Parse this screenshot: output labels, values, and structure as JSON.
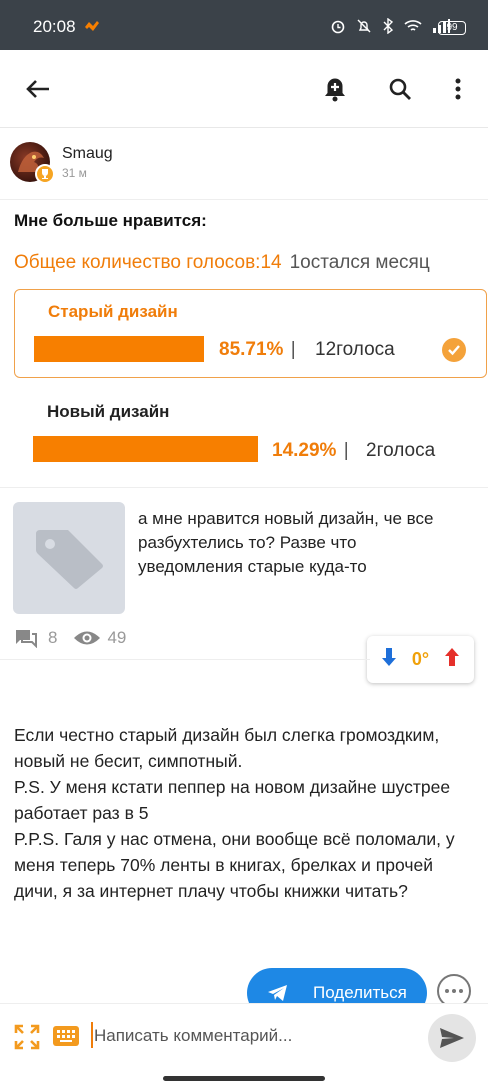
{
  "status_bar": {
    "time": "20:08",
    "battery": "99"
  },
  "author": {
    "name": "Smaug",
    "time": "31 м"
  },
  "poll": {
    "title": "Мне больше нравится:",
    "total_label": "Общее количество голосов:14",
    "remaining_label": "1остался месяц",
    "options": [
      {
        "label": "Старый дизайн",
        "percent": "85.71%",
        "percent_value": 85.71,
        "separator": "|",
        "votes": "12голоса",
        "selected": true
      },
      {
        "label": "Новый дизайн",
        "percent": "14.29%",
        "percent_value": 14.29,
        "separator": "|",
        "votes": "2голоса",
        "selected": false
      }
    ]
  },
  "linked_post": {
    "text": "а мне нравится новый дизайн, че все разбухтелись то? Разве что уведомления старые куда-то",
    "comments_count": "8",
    "views_count": "49"
  },
  "rating": {
    "value": "0°"
  },
  "comment": {
    "lines": [
      "Если честно старый дизайн был слегка громоздким, новый не бесит, симпотный.",
      "P.S. У меня кстати пеппер на новом дизайне шустрее работает раз в 5",
      "P.P.S. Галя у нас отмена, они вообще всё поломали, у меня теперь 70% ленты в книгах, брелках и прочей дичи, я за интернет плачу чтобы книжки читать?"
    ]
  },
  "actions": {
    "share_label": "Поделиться"
  },
  "input": {
    "placeholder": "Написать комментарий..."
  },
  "colors": {
    "accent": "#f77f00",
    "share": "#1e88e5",
    "status_bar": "#3b4249"
  }
}
